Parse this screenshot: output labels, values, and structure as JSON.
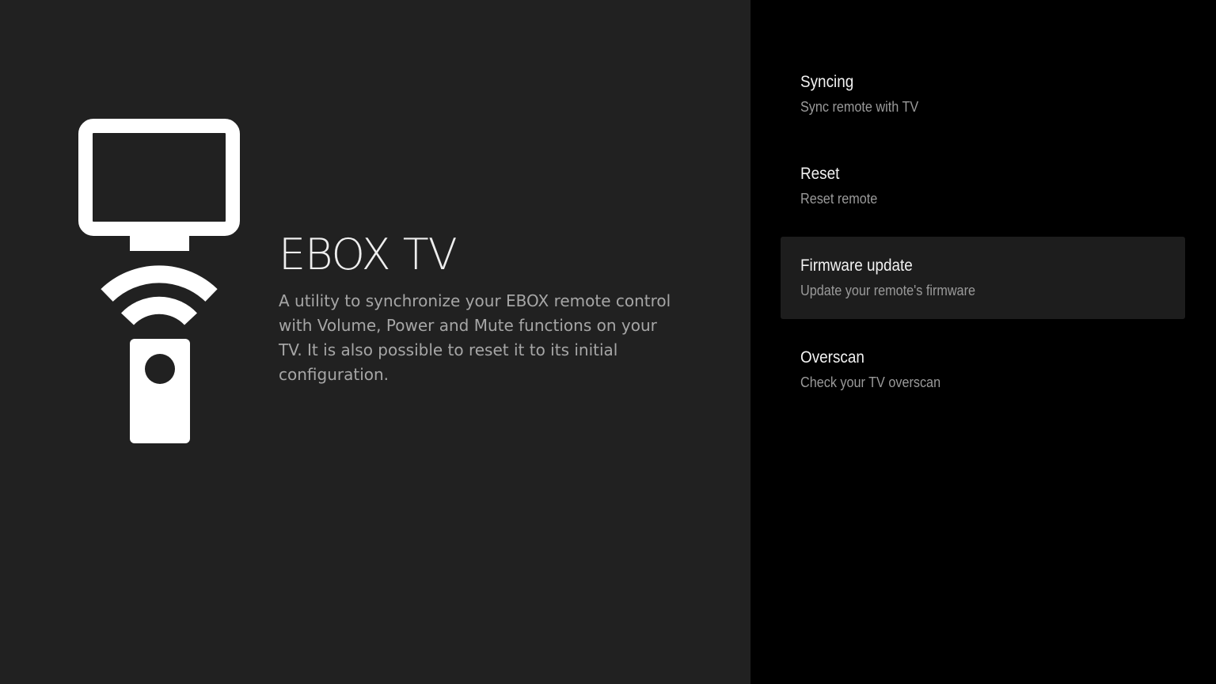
{
  "app": {
    "title": "EBOX TV",
    "description": "A utility to synchronize your EBOX remote control with Volume, Power and Mute functions on your TV. It is also possible to reset it to its initial configuration.",
    "icon": "tv-remote-sync-icon"
  },
  "menu": {
    "items": [
      {
        "title": "Syncing",
        "subtitle": "Sync remote with TV",
        "focused": false
      },
      {
        "title": "Reset",
        "subtitle": "Reset remote",
        "focused": false
      },
      {
        "title": "Firmware update",
        "subtitle": "Update your remote's firmware",
        "focused": true
      },
      {
        "title": "Overscan",
        "subtitle": "Check your TV overscan",
        "focused": false
      }
    ]
  },
  "colors": {
    "left_background": "#212121",
    "right_background": "#000000",
    "focused_item_background": "#1d1d1d",
    "title_text": "#eeeeee",
    "description_text": "#a6a6a6",
    "subtitle_text": "#9a9a9a"
  }
}
